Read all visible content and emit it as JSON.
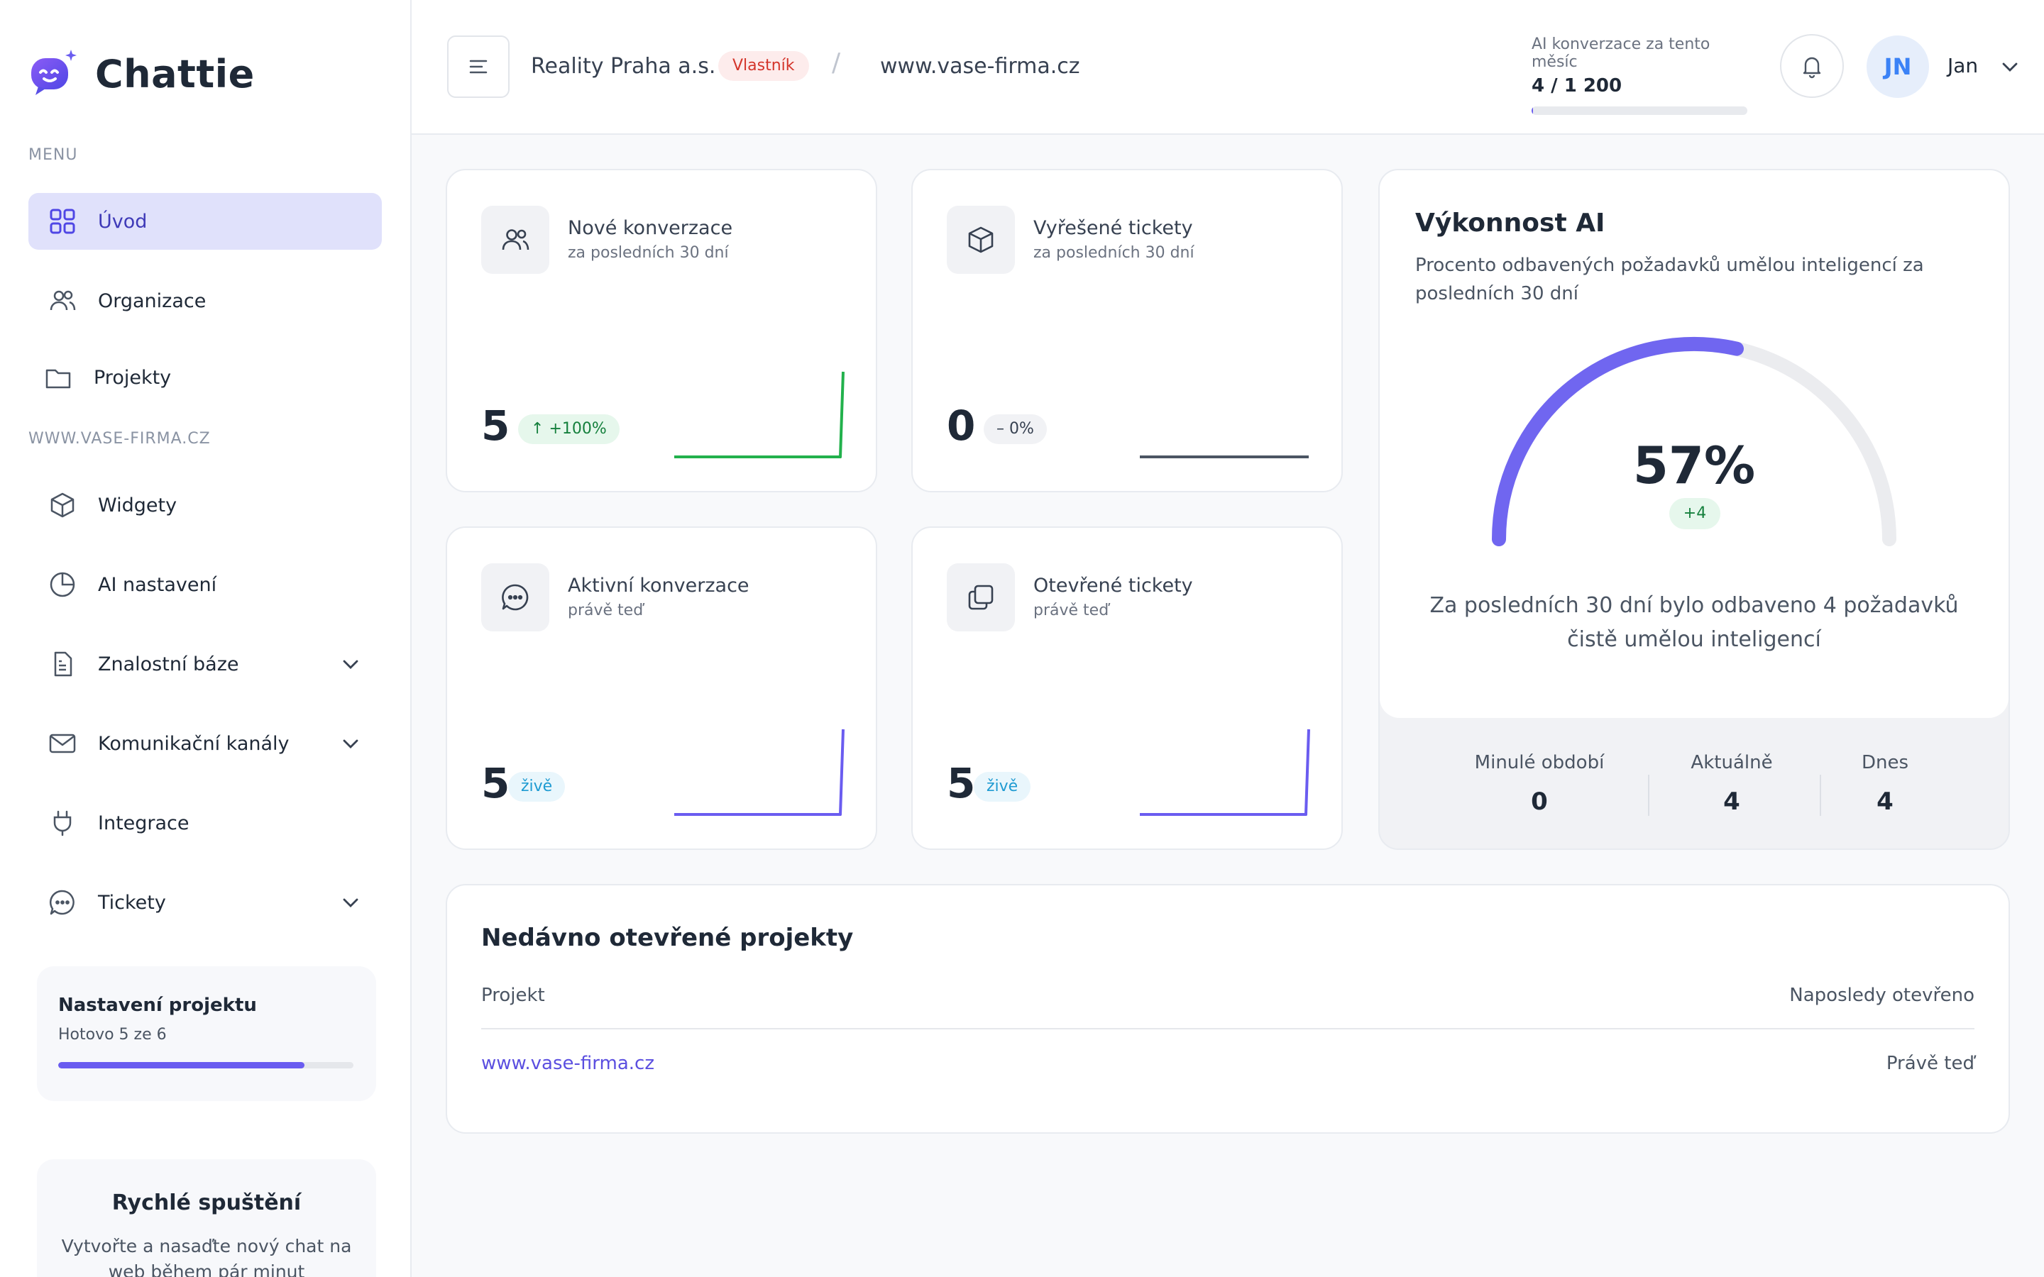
{
  "app": {
    "name": "Chattie"
  },
  "sidebar": {
    "menu_label": "MENU",
    "site_label": "WWW.VASE-FIRMA.CZ",
    "items": [
      {
        "label": "Úvod",
        "icon": "grid-icon",
        "active": true
      },
      {
        "label": "Organizace",
        "icon": "users-icon"
      },
      {
        "label": "Projekty",
        "icon": "folder-icon"
      },
      {
        "label": "Widgety",
        "icon": "cube-icon"
      },
      {
        "label": "AI nastavení",
        "icon": "pie-chart-icon"
      },
      {
        "label": "Znalostní báze",
        "icon": "document-icon",
        "expandable": true
      },
      {
        "label": "Komunikační kanály",
        "icon": "mail-icon",
        "expandable": true
      },
      {
        "label": "Integrace",
        "icon": "plug-icon"
      },
      {
        "label": "Tickety",
        "icon": "chat-bubble-icon",
        "expandable": true
      }
    ],
    "setup": {
      "title": "Nastavení projektu",
      "progress_text": "Hotovo 5 ze 6",
      "done": 5,
      "total": 6
    },
    "quick_start": {
      "title": "Rychlé spuštění",
      "text": "Vytvořte a nasaďte nový chat na web během pár minut"
    }
  },
  "header": {
    "org_name": "Reality Praha a.s.",
    "role_badge": "Vlastník",
    "separator": "/",
    "site": "www.vase-firma.cz",
    "quota_label": "AI konverzace za tento měsíc",
    "quota_value": "4 / 1 200",
    "quota_used": 4,
    "quota_total": 1200,
    "user_initials": "JN",
    "user_name": "Jan"
  },
  "stats": [
    {
      "title": "Nové konverzace",
      "subtitle": "za posledních 30 dní",
      "value": "5",
      "badge": "+100%",
      "badge_icon": "arrow-up-icon",
      "trend_color": "#22b14c"
    },
    {
      "title": "Vyřešené tickety",
      "subtitle": "za posledních 30 dní",
      "value": "0",
      "badge": "– 0%",
      "trend_color": "#4b5563"
    },
    {
      "title": "Aktivní konverzace",
      "subtitle": "právě teď",
      "value": "5",
      "badge": "živě",
      "trend_color": "#6a5cf0"
    },
    {
      "title": "Otevřené tickety",
      "subtitle": "právě teď",
      "value": "5",
      "badge": "živě",
      "trend_color": "#6a5cf0"
    }
  ],
  "ai": {
    "title": "Výkonnost AI",
    "description": "Procento odbavených požadavků umělou inteligencí za posledních 30 dní",
    "percent": 57,
    "percent_text": "57%",
    "delta": "+4",
    "summary": "Za posledních 30 dní bylo odbaveno 4 požadavků čistě umělou inteligencí",
    "stats": [
      {
        "label": "Minulé období",
        "value": "0"
      },
      {
        "label": "Aktuálně",
        "value": "4"
      },
      {
        "label": "Dnes",
        "value": "4"
      }
    ],
    "accent": "#7066f0"
  },
  "recent": {
    "title": "Nedávno otevřené projekty",
    "col_project": "Projekt",
    "col_opened": "Naposledy otevřeno",
    "rows": [
      {
        "project": "www.vase-firma.cz",
        "opened": "Právě teď"
      }
    ]
  }
}
